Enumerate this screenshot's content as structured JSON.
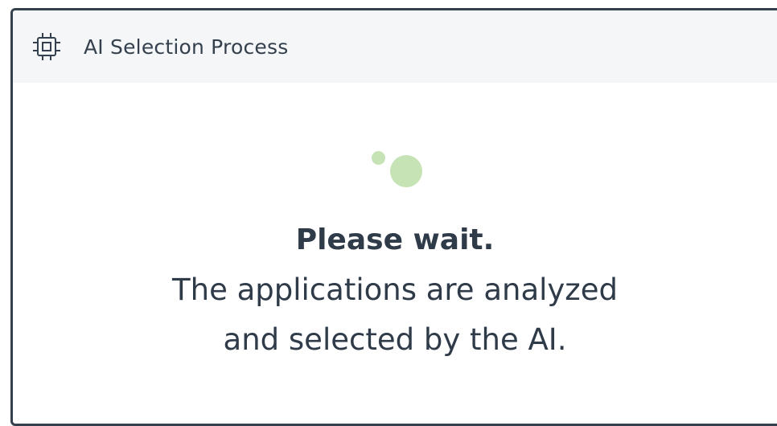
{
  "header": {
    "icon": "cpu-chip-icon",
    "title": "AI Selection Process"
  },
  "loader": {
    "icon": "loading-dots-icon",
    "color": "#c5e3b5"
  },
  "message": {
    "heading": "Please wait.",
    "line1": "The applications are analyzed",
    "line2": "and selected by the AI."
  },
  "colors": {
    "border": "#34404d",
    "header_bg": "#f5f6f7",
    "text": "#2f3b49"
  }
}
